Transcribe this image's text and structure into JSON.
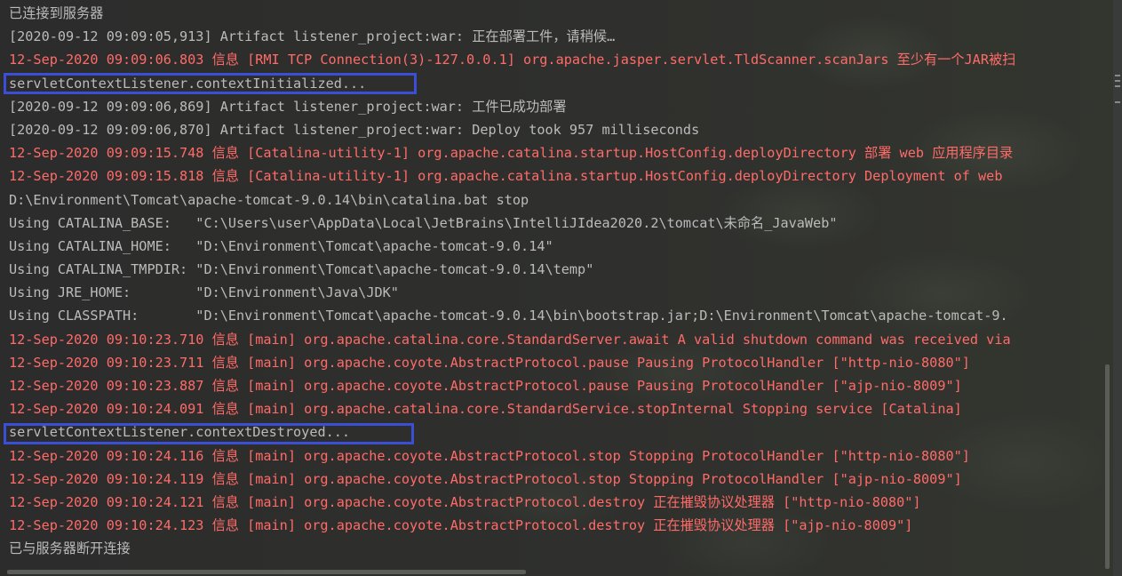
{
  "console": {
    "lines": [
      {
        "text": "已连接到服务器",
        "kind": "info"
      },
      {
        "text": "[2020-09-12 09:09:05,913] Artifact listener_project:war: 正在部署工件，请稍候…",
        "kind": "info"
      },
      {
        "text": "12-Sep-2020 09:09:06.803 信息 [RMI TCP Connection(3)-127.0.0.1] org.apache.jasper.servlet.TldScanner.scanJars 至少有一个JAR被扫",
        "kind": "err"
      },
      {
        "text": "servletContextListener.contextInitialized...",
        "kind": "info"
      },
      {
        "text": "[2020-09-12 09:09:06,869] Artifact listener_project:war: 工件已成功部署",
        "kind": "info"
      },
      {
        "text": "[2020-09-12 09:09:06,870] Artifact listener_project:war: Deploy took 957 milliseconds",
        "kind": "info"
      },
      {
        "text": "12-Sep-2020 09:09:15.748 信息 [Catalina-utility-1] org.apache.catalina.startup.HostConfig.deployDirectory 部署 web 应用程序目录",
        "kind": "err"
      },
      {
        "text": "12-Sep-2020 09:09:15.818 信息 [Catalina-utility-1] org.apache.catalina.startup.HostConfig.deployDirectory Deployment of web",
        "kind": "err"
      },
      {
        "text": "D:\\Environment\\Tomcat\\apache-tomcat-9.0.14\\bin\\catalina.bat stop",
        "kind": "info"
      },
      {
        "text": "Using CATALINA_BASE:   \"C:\\Users\\user\\AppData\\Local\\JetBrains\\IntelliJIdea2020.2\\tomcat\\未命名_JavaWeb\"",
        "kind": "info"
      },
      {
        "text": "Using CATALINA_HOME:   \"D:\\Environment\\Tomcat\\apache-tomcat-9.0.14\"",
        "kind": "info"
      },
      {
        "text": "Using CATALINA_TMPDIR: \"D:\\Environment\\Tomcat\\apache-tomcat-9.0.14\\temp\"",
        "kind": "info"
      },
      {
        "text": "Using JRE_HOME:        \"D:\\Environment\\Java\\JDK\"",
        "kind": "info"
      },
      {
        "text": "Using CLASSPATH:       \"D:\\Environment\\Tomcat\\apache-tomcat-9.0.14\\bin\\bootstrap.jar;D:\\Environment\\Tomcat\\apache-tomcat-9.",
        "kind": "info"
      },
      {
        "text": "12-Sep-2020 09:10:23.710 信息 [main] org.apache.catalina.core.StandardServer.await A valid shutdown command was received via",
        "kind": "err"
      },
      {
        "text": "12-Sep-2020 09:10:23.711 信息 [main] org.apache.coyote.AbstractProtocol.pause Pausing ProtocolHandler [\"http-nio-8080\"]",
        "kind": "err"
      },
      {
        "text": "12-Sep-2020 09:10:23.887 信息 [main] org.apache.coyote.AbstractProtocol.pause Pausing ProtocolHandler [\"ajp-nio-8009\"]",
        "kind": "err"
      },
      {
        "text": "12-Sep-2020 09:10:24.091 信息 [main] org.apache.catalina.core.StandardService.stopInternal Stopping service [Catalina]",
        "kind": "err"
      },
      {
        "text": "servletContextListener.contextDestroyed...",
        "kind": "info"
      },
      {
        "text": "12-Sep-2020 09:10:24.116 信息 [main] org.apache.coyote.AbstractProtocol.stop Stopping ProtocolHandler [\"http-nio-8080\"]",
        "kind": "err"
      },
      {
        "text": "12-Sep-2020 09:10:24.119 信息 [main] org.apache.coyote.AbstractProtocol.stop Stopping ProtocolHandler [\"ajp-nio-8009\"]",
        "kind": "err"
      },
      {
        "text": "12-Sep-2020 09:10:24.121 信息 [main] org.apache.coyote.AbstractProtocol.destroy 正在摧毁协议处理器 [\"http-nio-8080\"]",
        "kind": "err"
      },
      {
        "text": "12-Sep-2020 09:10:24.123 信息 [main] org.apache.coyote.AbstractProtocol.destroy 正在摧毁协议处理器 [\"ajp-nio-8009\"]",
        "kind": "err"
      },
      {
        "text": "已与服务器断开连接",
        "kind": "info"
      }
    ]
  },
  "colors": {
    "error_text": "#ff6b68",
    "normal_text": "#bbbbbb",
    "highlight_border": "#3a4fd6"
  }
}
